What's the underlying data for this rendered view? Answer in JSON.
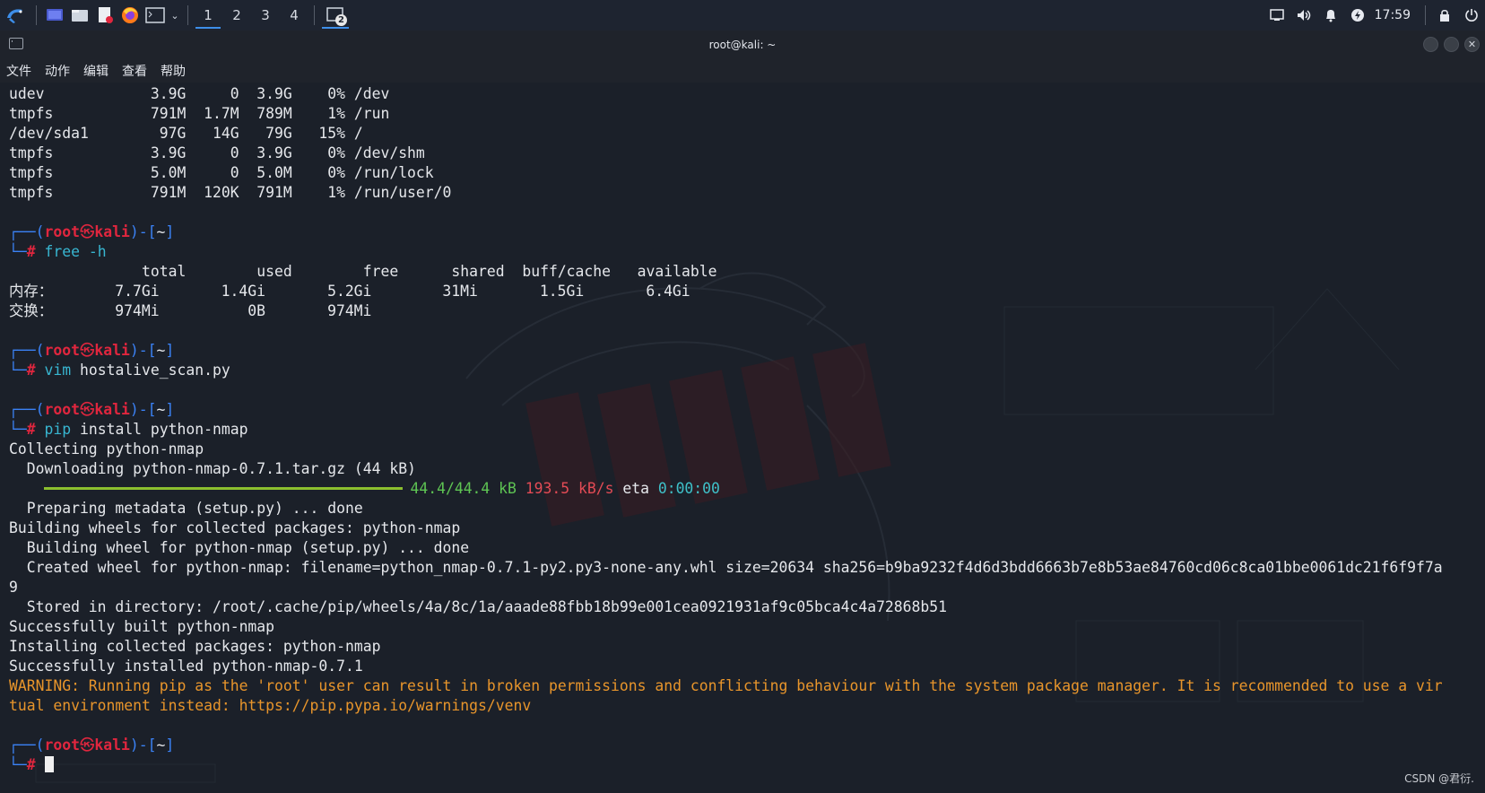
{
  "taskbar": {
    "workspaces": [
      "1",
      "2",
      "3",
      "4"
    ],
    "active_workspace": "1",
    "terminal_badge": "2",
    "clock": "17:59",
    "icons": [
      "kali-menu-icon",
      "desktop-icon",
      "file-manager-icon",
      "text-editor-icon",
      "firefox-icon",
      "terminal-icon"
    ]
  },
  "window": {
    "title": "root@kali: ~",
    "menu": [
      "文件",
      "动作",
      "编辑",
      "查看",
      "帮助"
    ]
  },
  "terminal": {
    "df_rows": [
      "udev            3.9G     0  3.9G    0% /dev",
      "tmpfs           791M  1.7M  789M    1% /run",
      "/dev/sda1        97G   14G   79G   15% /",
      "tmpfs           3.9G     0  3.9G    0% /dev/shm",
      "tmpfs           5.0M     0  5.0M    0% /run/lock",
      "tmpfs           791M  120K  791M    1% /run/user/0"
    ],
    "prompt": {
      "line_prefix": "┌──(",
      "user": "root",
      "skull": "㉿",
      "host": "kali",
      "mid": ")-[",
      "dir": "~",
      "end": "]",
      "hash_prefix": "└─",
      "hash": "#"
    },
    "cmd1_name": "free",
    "cmd1_args": " -h",
    "free_header": "               total        used        free      shared  buff/cache   available",
    "free_mem_label": "内存：",
    "free_mem_values": "       7.7Gi       1.4Gi       5.2Gi        31Mi       1.5Gi       6.4Gi",
    "free_swap_label": "交换：",
    "free_swap_values": "       974Mi          0B       974Mi",
    "cmd2_name": "vim",
    "cmd2_args": " hostalive_scan.py",
    "cmd3_name": "pip",
    "cmd3_args": " install python-nmap",
    "pip_out1": "Collecting python-nmap",
    "pip_out2": "  Downloading python-nmap-0.7.1.tar.gz (44 kB)",
    "progress": {
      "fraction": 1.0,
      "size": "44.4/44.4 kB",
      "speed": "193.5 kB/s",
      "eta_label": "eta",
      "eta": "0:00:00"
    },
    "pip_out3": "  Preparing metadata (setup.py) ... done",
    "pip_out4": "Building wheels for collected packages: python-nmap",
    "pip_out5": "  Building wheel for python-nmap (setup.py) ... done",
    "pip_out6": "  Created wheel for python-nmap: filename=python_nmap-0.7.1-py2.py3-none-any.whl size=20634 sha256=b9ba9232f4d6d3bdd6663b7e8b53ae84760cd06c8ca01bbe0061dc21f6f9f7a",
    "pip_out6b": "9",
    "pip_out7": "  Stored in directory: /root/.cache/pip/wheels/4a/8c/1a/aaade88fbb18b99e001cea0921931af9c05bca4c4a72868b51",
    "pip_out8": "Successfully built python-nmap",
    "pip_out9": "Installing collected packages: python-nmap",
    "pip_out10": "Successfully installed python-nmap-0.7.1",
    "warning1": "WARNING: Running pip as the 'root' user can result in broken permissions and conflicting behaviour with the system package manager. It is recommended to use a vir",
    "warning2": "tual environment instead: https://pip.pypa.io/warnings/venv"
  },
  "watermark_text": "CSDN @君衍."
}
